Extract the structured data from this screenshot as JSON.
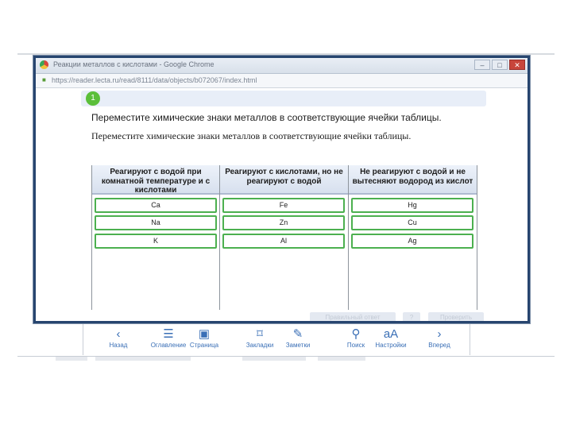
{
  "window": {
    "title": "Реакции металлов с кислотами - Google Chrome",
    "url": "https://reader.lecta.ru/read/8111/data/objects/b072067/index.html",
    "controls": [
      "–",
      "□",
      "✕"
    ]
  },
  "exercise": {
    "number": "1",
    "instruction_primary": "Переместите химические знаки металлов в соответствующие ячейки таблицы.",
    "instruction_secondary": "Переместите химические знаки металлов в соответствующие ячейки таблицы."
  },
  "table": {
    "columns": [
      {
        "header": "Реагируют с водой при комнатной температуре и с кислотами",
        "items": [
          "Ca",
          "Na",
          "K"
        ]
      },
      {
        "header": "Реагируют с кислотами, но не реагируют с водой",
        "items": [
          "Fe",
          "Zn",
          "Al"
        ]
      },
      {
        "header": "Не реагируют с водой и не вытесняют водород из кислот",
        "items": [
          "Hg",
          "Cu",
          "Ag"
        ]
      }
    ]
  },
  "footer_buttons": [
    "Правильный ответ",
    "?",
    "Проверить"
  ],
  "reader_toolbar": [
    {
      "label": "Назад",
      "icon": "chevron-left-icon",
      "glyph": "‹"
    },
    {
      "label": "Оглавление",
      "icon": "list-icon",
      "glyph": "☰"
    },
    {
      "label": "Страница",
      "icon": "page-icon",
      "glyph": "▣"
    },
    {
      "label": "Закладки",
      "icon": "bookmark-icon",
      "glyph": "⌑"
    },
    {
      "label": "Заметки",
      "icon": "notes-icon",
      "glyph": "✎"
    },
    {
      "label": "Поиск",
      "icon": "search-icon",
      "glyph": "⚲"
    },
    {
      "label": "Настройки",
      "icon": "font-settings-icon",
      "glyph": "aA"
    },
    {
      "label": "Вперед",
      "icon": "chevron-right-icon",
      "glyph": "›"
    }
  ]
}
